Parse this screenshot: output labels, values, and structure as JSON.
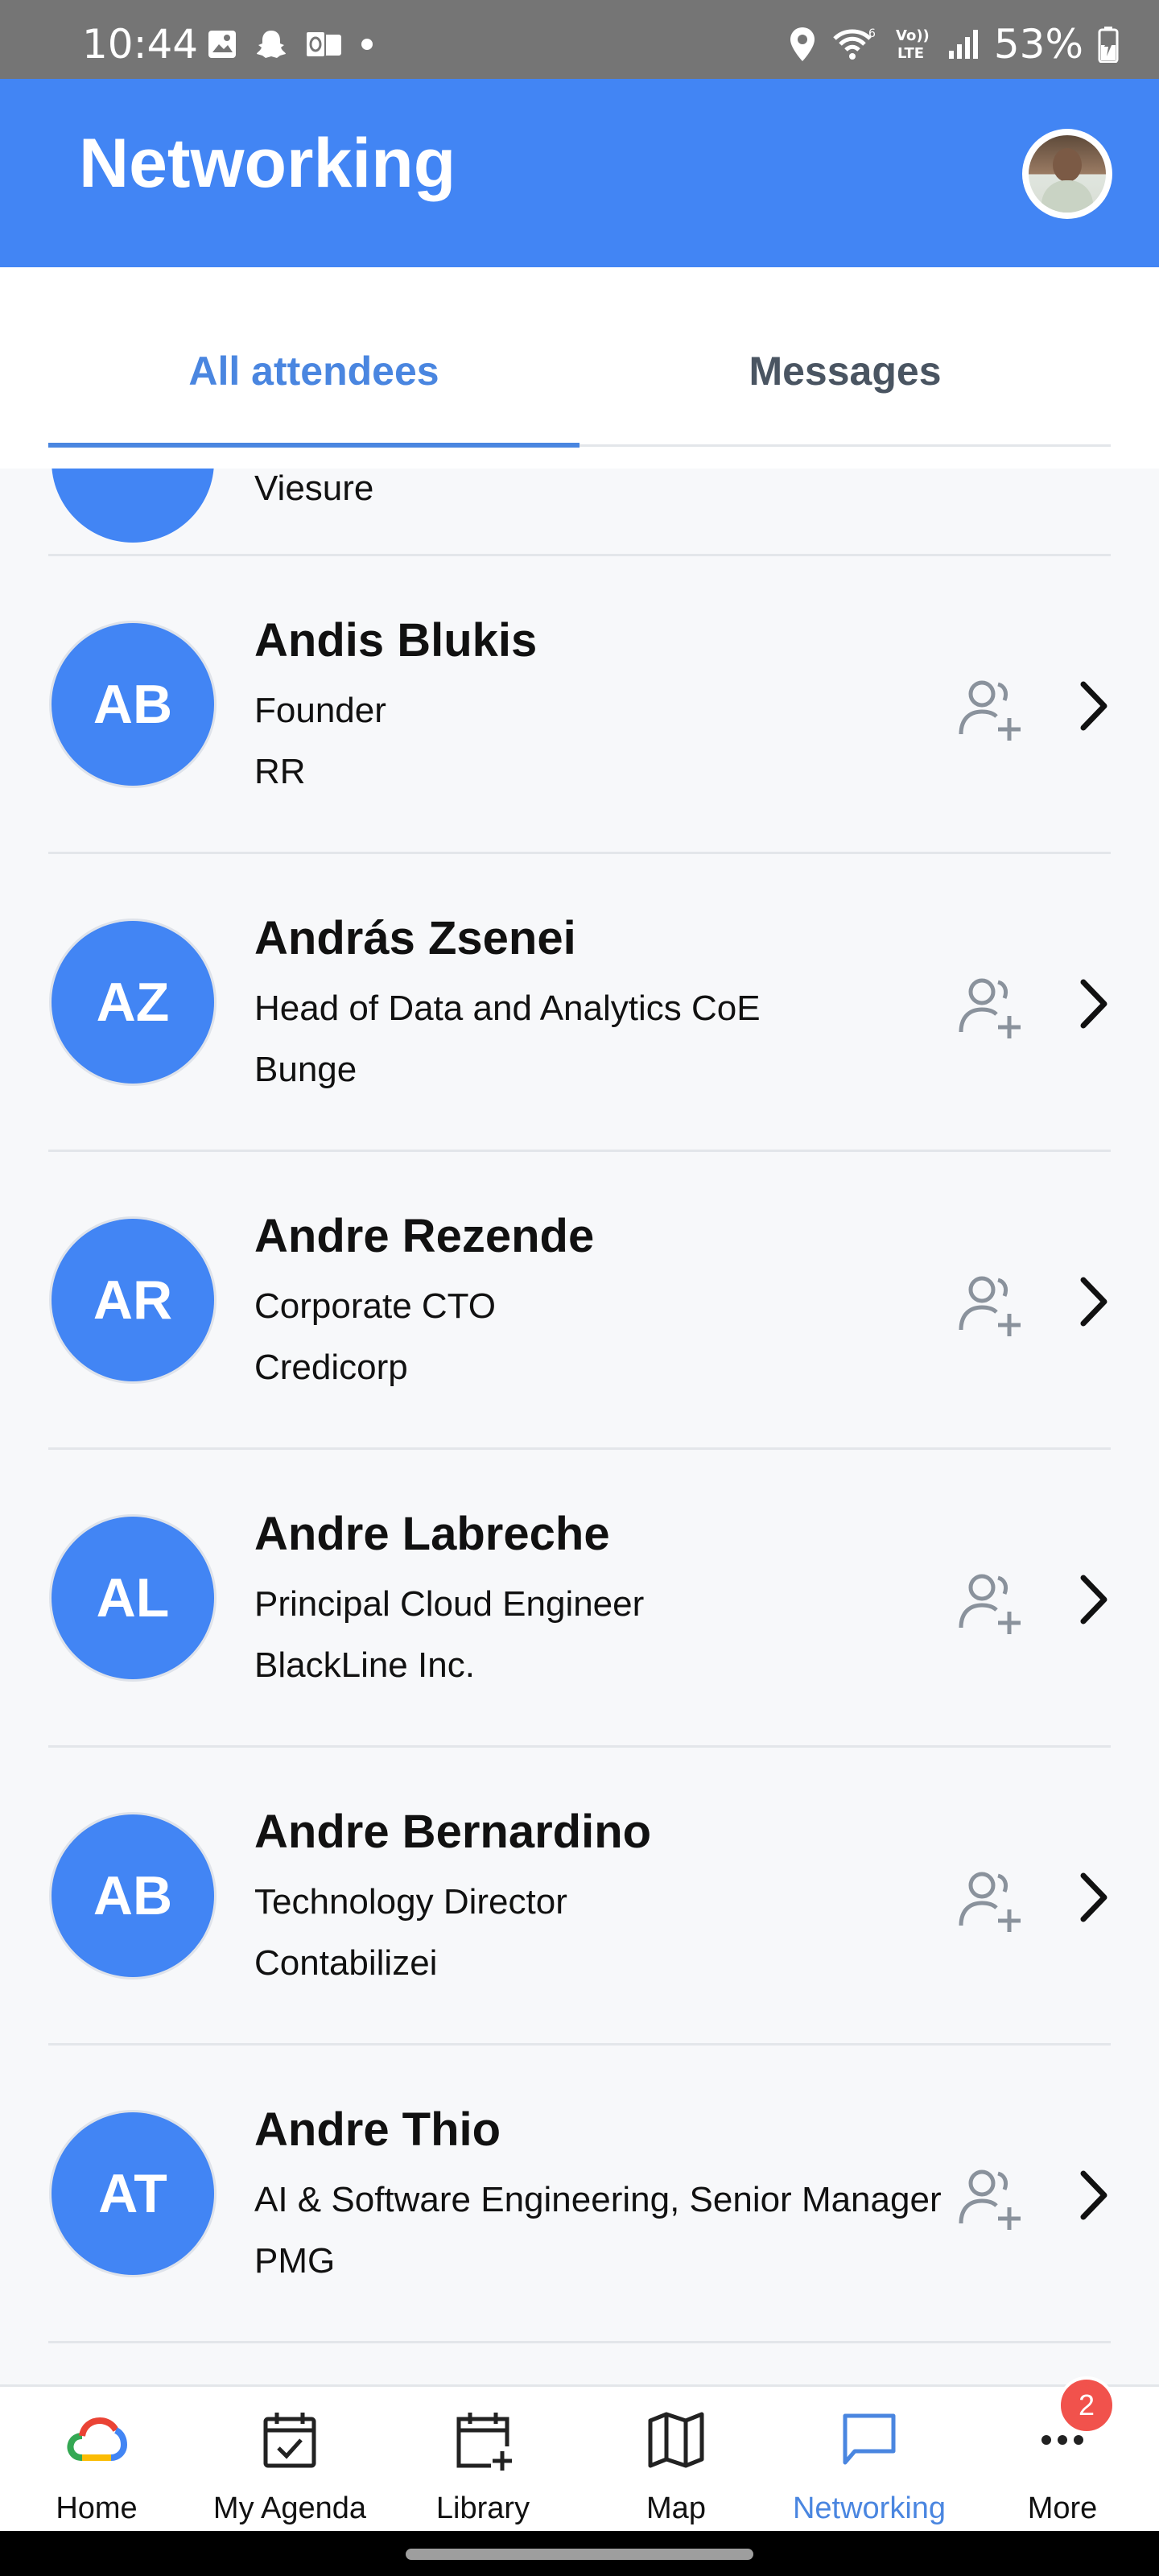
{
  "status_bar": {
    "time": "10:44",
    "battery": "53%",
    "notification_icons": [
      "gallery-icon",
      "snapchat-icon",
      "outlook-icon",
      "dot-icon"
    ],
    "system_icons": [
      "location-icon",
      "wifi-6-icon",
      "volte-icon",
      "signal-icon",
      "battery-charging-icon"
    ]
  },
  "app_bar": {
    "title": "Networking",
    "accent_color": "#4285f4"
  },
  "tabs": [
    {
      "label": "All attendees",
      "active": true
    },
    {
      "label": "Messages",
      "active": false
    }
  ],
  "attendees_partial": {
    "company": "Viesure"
  },
  "attendees": [
    {
      "initials": "AB",
      "name": "Andis Blukis",
      "role": "Founder",
      "company": "RR"
    },
    {
      "initials": "AZ",
      "name": "András Zsenei",
      "role": "Head of Data and Analytics CoE",
      "company": "Bunge"
    },
    {
      "initials": "AR",
      "name": "Andre Rezende",
      "role": "Corporate CTO",
      "company": "Credicorp"
    },
    {
      "initials": "AL",
      "name": "Andre Labreche",
      "role": "Principal Cloud Engineer",
      "company": "BlackLine Inc."
    },
    {
      "initials": "AB",
      "name": "Andre Bernardino",
      "role": "Technology Director",
      "company": "Contabilizei"
    },
    {
      "initials": "AT",
      "name": "Andre Thio",
      "role": "AI & Software Engineering, Senior Manager",
      "company": "PMG"
    }
  ],
  "bottom_nav": [
    {
      "label": "Home",
      "icon": "google-cloud-icon"
    },
    {
      "label": "My Agenda",
      "icon": "calendar-check-icon"
    },
    {
      "label": "Library",
      "icon": "calendar-add-icon"
    },
    {
      "label": "Map",
      "icon": "map-icon"
    },
    {
      "label": "Networking",
      "icon": "chat-icon",
      "active": true
    },
    {
      "label": "More",
      "icon": "more-icon",
      "badge": "2"
    }
  ]
}
